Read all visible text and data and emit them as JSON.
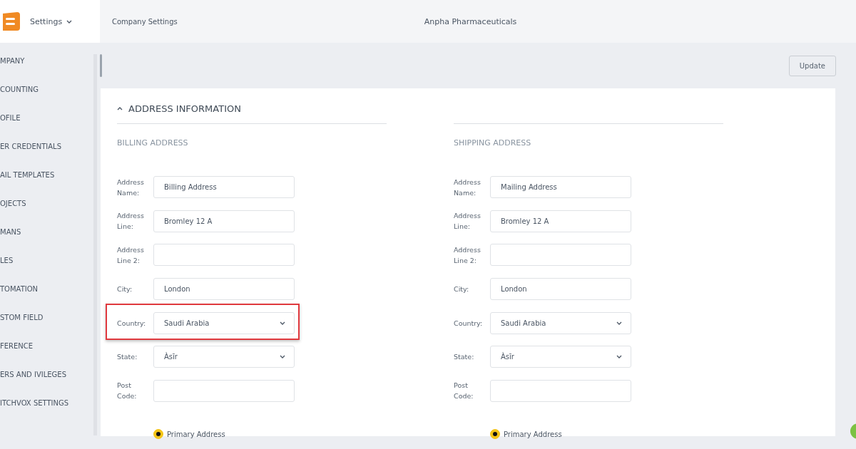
{
  "header": {
    "menu_label": "Settings",
    "breadcrumb": "Company Settings",
    "company": "Anpha Pharmaceuticals"
  },
  "sidebar": {
    "items": [
      {
        "label": "MPANY"
      },
      {
        "label": "COUNTING"
      },
      {
        "label": "OFILE"
      },
      {
        "label": "ER CREDENTIALS"
      },
      {
        "label": "AIL TEMPLATES"
      },
      {
        "label": "OJECTS"
      },
      {
        "label": "MANS"
      },
      {
        "label": "LES"
      },
      {
        "label": "TOMATION"
      },
      {
        "label": "STOM FIELD"
      },
      {
        "label": "FERENCE"
      },
      {
        "label": "ERS AND IVILEGES"
      },
      {
        "label": "ITCHVOX SETTINGS"
      }
    ]
  },
  "toolbar": {
    "button": "Update"
  },
  "section": {
    "title": "ADDRESS INFORMATION",
    "expanded": true,
    "columns": [
      {
        "heading": "BILLING ADDRESS",
        "fields": [
          {
            "label": "Address Name:",
            "kind": "input",
            "value": "Billing Address",
            "highlighted": false
          },
          {
            "label": "Address Line:",
            "kind": "input",
            "value": "Bromley 12 A",
            "highlighted": false
          },
          {
            "label": "Address Line 2:",
            "kind": "input",
            "highlighted": false
          },
          {
            "label": "City:",
            "kind": "input",
            "value": "London",
            "highlighted": false
          },
          {
            "label": "Country:",
            "kind": "select",
            "value": "Saudi Arabia",
            "highlighted": true
          },
          {
            "label": "State:",
            "kind": "select",
            "value": "Àsīr",
            "highlighted": false
          },
          {
            "label": "Post Code:",
            "kind": "input",
            "highlighted": false
          }
        ],
        "radio": {
          "label": "Primary Address",
          "selected": true
        }
      },
      {
        "heading": "SHIPPING ADDRESS",
        "fields": [
          {
            "label": "Address Name:",
            "kind": "input",
            "value": "Mailing Address",
            "highlighted": false
          },
          {
            "label": "Address Line:",
            "kind": "input",
            "value": "Bromley 12 A",
            "highlighted": false
          },
          {
            "label": "Address Line 2:",
            "kind": "input",
            "highlighted": false
          },
          {
            "label": "City:",
            "kind": "input",
            "value": "London",
            "highlighted": false
          },
          {
            "label": "Country:",
            "kind": "select",
            "value": "Saudi Arabia",
            "highlighted": false
          },
          {
            "label": "State:",
            "kind": "select",
            "value": "Àsīr",
            "highlighted": false
          },
          {
            "label": "Post Code:",
            "kind": "input",
            "highlighted": false
          }
        ],
        "radio": {
          "label": "Primary Address",
          "selected": true
        }
      }
    ]
  }
}
